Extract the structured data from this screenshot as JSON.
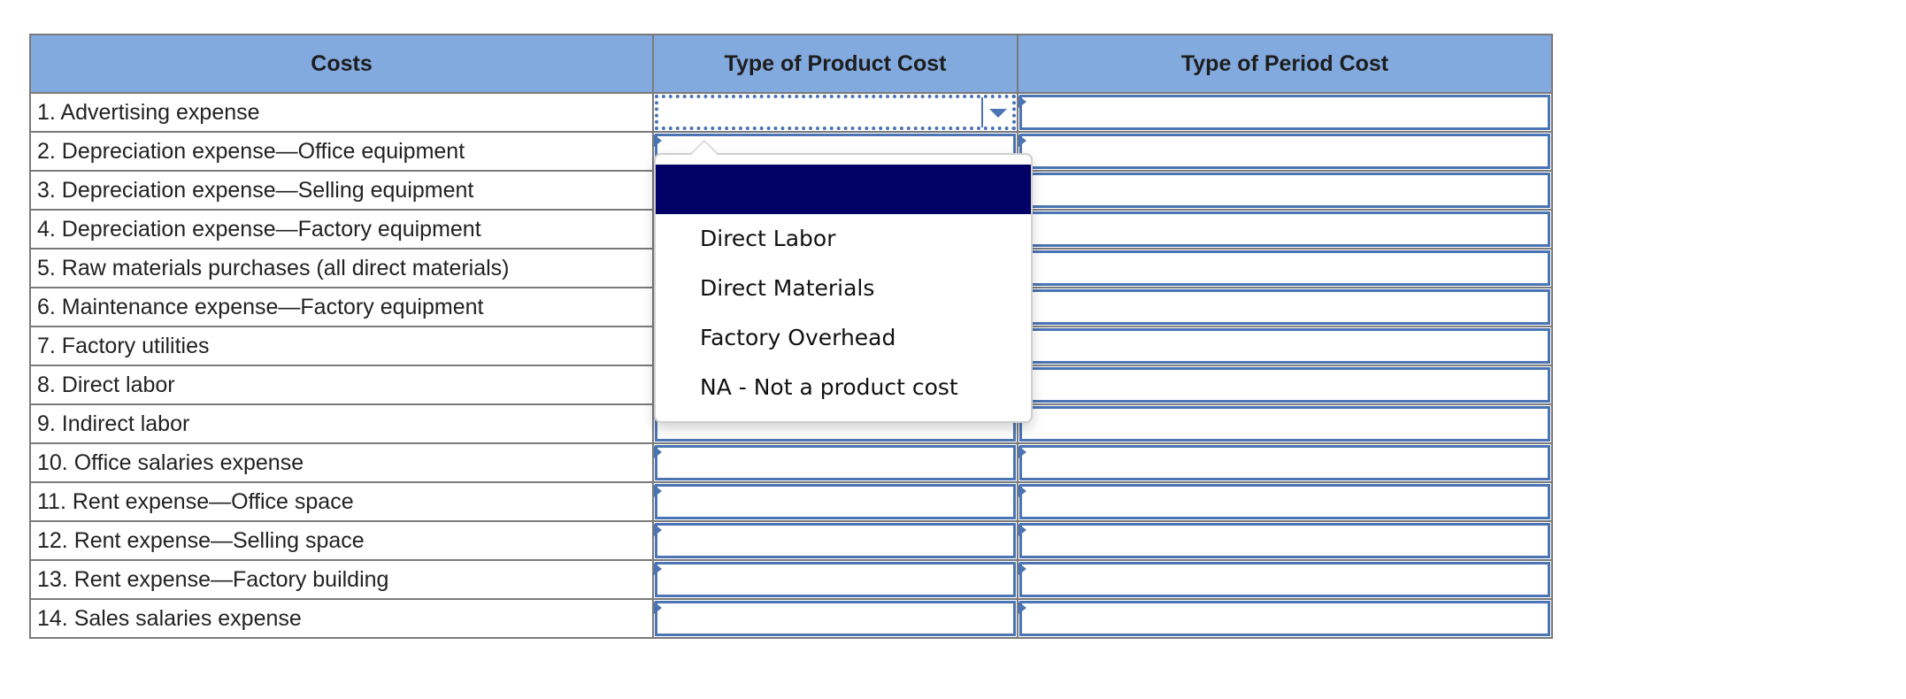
{
  "table": {
    "headers": [
      "Costs",
      "Type of Product Cost",
      "Type of Period Cost"
    ],
    "rows": [
      {
        "cost": "1. Advertising expense",
        "product_cost": "",
        "period_cost": ""
      },
      {
        "cost": "2. Depreciation expense—Office equipment",
        "product_cost": "",
        "period_cost": ""
      },
      {
        "cost": "3. Depreciation expense—Selling equipment",
        "product_cost": "",
        "period_cost": ""
      },
      {
        "cost": "4. Depreciation expense—Factory equipment",
        "product_cost": "",
        "period_cost": ""
      },
      {
        "cost": "5. Raw materials purchases (all direct materials)",
        "product_cost": "",
        "period_cost": ""
      },
      {
        "cost": "6. Maintenance expense—Factory equipment",
        "product_cost": "",
        "period_cost": ""
      },
      {
        "cost": "7. Factory utilities",
        "product_cost": "",
        "period_cost": ""
      },
      {
        "cost": "8. Direct labor",
        "product_cost": "",
        "period_cost": ""
      },
      {
        "cost": "9. Indirect labor",
        "product_cost": "",
        "period_cost": ""
      },
      {
        "cost": "10. Office salaries expense",
        "product_cost": "",
        "period_cost": ""
      },
      {
        "cost": "11. Rent expense—Office space",
        "product_cost": "",
        "period_cost": ""
      },
      {
        "cost": "12. Rent expense—Selling space",
        "product_cost": "",
        "period_cost": ""
      },
      {
        "cost": "13. Rent expense—Factory building",
        "product_cost": "",
        "period_cost": ""
      },
      {
        "cost": "14. Sales salaries expense",
        "product_cost": "",
        "period_cost": ""
      }
    ]
  },
  "dropdown": {
    "open_for_row": 1,
    "column": "Type of Product Cost",
    "highlighted_option": "",
    "options": [
      "",
      "Direct Labor",
      "Direct Materials",
      "Factory Overhead",
      "NA - Not a product cost"
    ]
  },
  "colors": {
    "header_bg": "#82aadf",
    "select_border": "#4a74b4",
    "highlight": "#000066",
    "grid_line": "#7a7a7a"
  }
}
